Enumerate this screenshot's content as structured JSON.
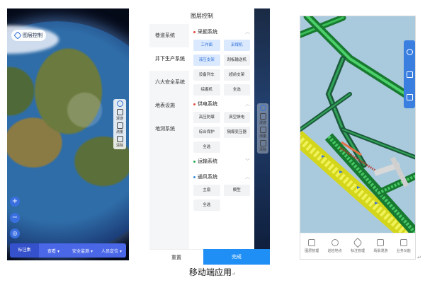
{
  "caption": "移动端应用",
  "phone1": {
    "layer_button": "图层控制",
    "tools": [
      "漫游",
      "测量",
      "清除"
    ],
    "zoom_in": "+",
    "zoom_out": "−",
    "bottom_tabs": [
      "标注集",
      "查看 ▾",
      "安全监测 ▾",
      "人员定位 ▾"
    ]
  },
  "phone2": {
    "title": "图层控制",
    "nav": [
      "巷道系统",
      "井下生产系统",
      "六大安全系统",
      "地表设施",
      "地测系统"
    ],
    "active_nav": "井下生产系统",
    "sections": [
      {
        "name": "采掘系统",
        "chips": [
          "工作面",
          "采煤机",
          "液压支架",
          "刮板输送机",
          "设备列车",
          "超前支架",
          "综掘机",
          "全选"
        ]
      },
      {
        "name": "供电系统",
        "chips": [
          "高压防爆",
          "真空馈电",
          "综合保护",
          "隔爆变压器",
          "全选"
        ]
      },
      {
        "name": "运输系统",
        "chips": []
      },
      {
        "name": "通风系统",
        "chips": [
          "主扇",
          "模型",
          "全选"
        ]
      }
    ],
    "selected_chips": [
      "工作面",
      "采煤机",
      "液压支架"
    ],
    "reset": "重置",
    "done": "完成"
  },
  "phone3": {
    "tabs": [
      "图层管理",
      "巡检地点",
      "标注管理",
      "场景漫游",
      "业务功能"
    ]
  },
  "colors": {
    "accent_blue": "#1f8ff5",
    "bar_blue": "#4a67e8",
    "tunnel_green": "#1f9a3a",
    "tunnel_yellow": "#e6e82a"
  }
}
